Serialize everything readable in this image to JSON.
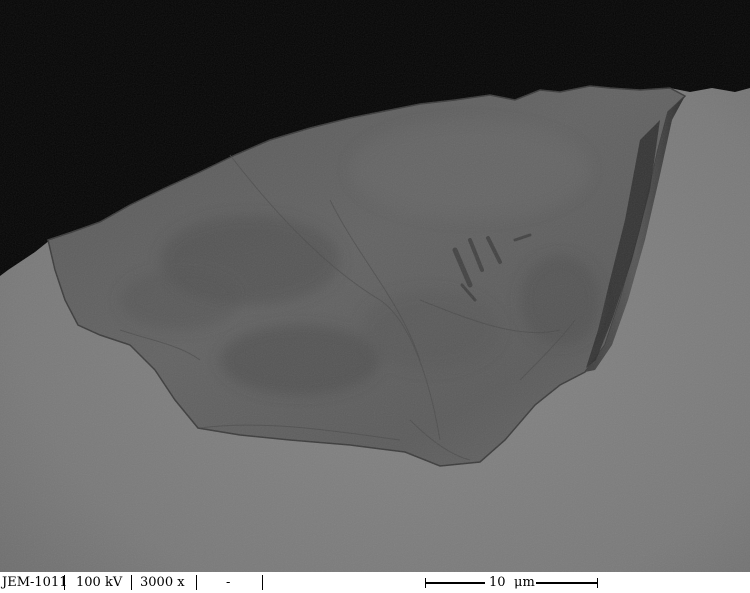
{
  "databar": {
    "instrument": "JEM-1011",
    "voltage": "100 kV",
    "magnification": "3000 x",
    "spare": "-",
    "scale_value": "10",
    "scale_unit": "μm"
  },
  "colors": {
    "vacuum": "#050505",
    "film_background": "#7a7a7a",
    "particle": "#5e5e5e",
    "particle_edge": "#3a3a3a"
  }
}
